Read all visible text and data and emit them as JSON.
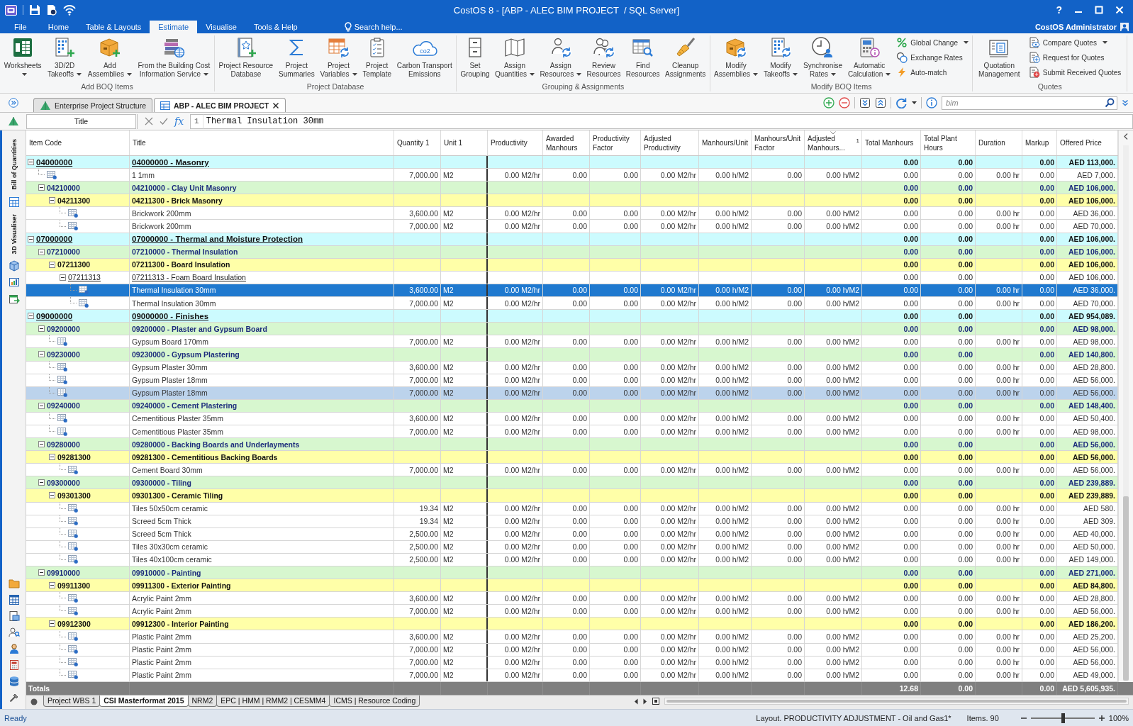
{
  "window": {
    "title": "CostOS 8 - [ABP - ALEC BIM PROJECT  / SQL Server]",
    "help": "?"
  },
  "menu": {
    "tabs": [
      {
        "label": "File",
        "selected": false
      },
      {
        "label": "Home",
        "selected": false
      },
      {
        "label": "Table & Layouts",
        "selected": false
      },
      {
        "label": "Estimate",
        "selected": true
      },
      {
        "label": "Visualise",
        "selected": false
      },
      {
        "label": "Tools & Help",
        "selected": false
      }
    ],
    "search": {
      "placeholder": "Search help..."
    },
    "user": "CostOS Administrator"
  },
  "ribbon": {
    "groups": [
      {
        "label": "Add BOQ Items",
        "buttons": [
          {
            "kind": "large",
            "label": "Worksheets",
            "has_menu": true
          },
          {
            "kind": "large",
            "label": "3D/2D Takeoffs",
            "has_menu": true
          },
          {
            "kind": "large",
            "label": "Add Assemblies",
            "has_menu": true
          },
          {
            "kind": "large",
            "label": "From the Building Cost Information Service",
            "has_menu": true
          }
        ]
      },
      {
        "label": "Project Database",
        "buttons": [
          {
            "kind": "large",
            "label": "Project Resource Database",
            "has_menu": false
          },
          {
            "kind": "large",
            "label": "Project Summaries",
            "has_menu": false
          },
          {
            "kind": "large",
            "label": "Project Variables",
            "has_menu": true
          },
          {
            "kind": "large",
            "label": "Project Template",
            "has_menu": false
          },
          {
            "kind": "large",
            "label": "Carbon Transport Emissions",
            "has_menu": false,
            "icon_text": "co2"
          }
        ]
      },
      {
        "label": "Grouping & Assignments",
        "buttons": [
          {
            "kind": "large",
            "label": "Set Grouping",
            "has_menu": false
          },
          {
            "kind": "large",
            "label": "Assign Quantities",
            "has_menu": true
          },
          {
            "kind": "large",
            "label": "Assign Resources",
            "has_menu": true
          },
          {
            "kind": "large",
            "label": "Review Resources",
            "has_menu": false
          },
          {
            "kind": "large",
            "label": "Find Resources",
            "has_menu": false
          },
          {
            "kind": "large",
            "label": "Cleanup Assignments",
            "has_menu": false
          }
        ]
      },
      {
        "label": "Modify BOQ Items",
        "buttons": [
          {
            "kind": "large",
            "label": "Modify Assemblies",
            "has_menu": true
          },
          {
            "kind": "large",
            "label": "Modify Takeoffs",
            "has_menu": true
          },
          {
            "kind": "large",
            "label": "Synchronise Rates",
            "has_menu": true
          },
          {
            "kind": "large",
            "label": "Automatic Calculation",
            "has_menu": true
          },
          {
            "kind": "small",
            "label": "Global Change",
            "has_menu": true
          },
          {
            "kind": "small",
            "label": "Exchange Rates",
            "has_menu": false
          },
          {
            "kind": "small",
            "label": "Auto-match",
            "has_menu": false
          }
        ]
      },
      {
        "label": "Quotes",
        "buttons": [
          {
            "kind": "large",
            "label": "Quotation Management",
            "has_menu": false
          },
          {
            "kind": "small",
            "label": "Compare Quotes",
            "has_menu": true
          },
          {
            "kind": "small",
            "label": "Request for Quotes",
            "has_menu": false
          },
          {
            "kind": "small",
            "label": "Submit Received Quotes",
            "has_menu": false
          }
        ]
      }
    ]
  },
  "document_tabs": [
    {
      "label": "Enterprise Project Structure",
      "selected": false,
      "closable": false
    },
    {
      "label": "ABP - ALEC BIM PROJECT",
      "selected": true,
      "closable": true
    }
  ],
  "toolbar": {
    "search": {
      "value": "bim"
    }
  },
  "formula_bar": {
    "field": "Title",
    "function_label": "fx",
    "line_number": "1",
    "value": "Thermal Insulation 30mm"
  },
  "side_panel": {
    "tabs": [
      {
        "label": "Bill of Quantities"
      },
      {
        "label": "3D Visualiser"
      }
    ]
  },
  "table": {
    "columns": [
      {
        "label": "Item Code"
      },
      {
        "label": "Title"
      },
      {
        "label": "Quantity 1"
      },
      {
        "label": "Unit 1"
      },
      {
        "label": "Productivity"
      },
      {
        "label": "Awarded Manhours"
      },
      {
        "label": "Productivity Factor"
      },
      {
        "label": "Adjusted Productivity"
      },
      {
        "label": "Manhours/Unit"
      },
      {
        "label": "Manhours/Unit Factor"
      },
      {
        "label": "Adjusted Manhours...",
        "sort_index": "1"
      },
      {
        "label": "Total Manhours"
      },
      {
        "label": "Total Plant Hours"
      },
      {
        "label": "Duration"
      },
      {
        "label": "Markup"
      },
      {
        "label": "Offered Price"
      }
    ],
    "rows": [
      {
        "kind": "group",
        "code": "04000000",
        "title": "04000000 - Masonry",
        "expanded": true,
        "selected": false,
        "focused": false,
        "total_manhours": "0.00",
        "total_plant_hours": "0.00",
        "markup": "0.00",
        "offered_price": "AED 113,000.",
        "children": [
          {
            "kind": "item",
            "title": "1 1mm",
            "quantity_1": "7,000.00",
            "unit_1": "M2",
            "productivity": "0.00 M2/hr",
            "awarded_manhours": "0.00",
            "productivity_factor": "0.00",
            "adjusted_productivity": "0.00 M2/hr",
            "manhours_per_unit": "0.00 h/M2",
            "manhours_per_unit_factor": "0.00",
            "adjusted_manhours": "0.00 h/M2",
            "total_manhours": "0.00",
            "total_plant_hours": "0.00",
            "duration": "0.00 hr",
            "markup": "0.00",
            "offered_price": "AED 7,000.",
            "selected": false,
            "focused": false
          },
          {
            "kind": "group",
            "code": "04210000",
            "title": "04210000 - Clay Unit Masonry",
            "expanded": true,
            "selected": false,
            "focused": false,
            "total_manhours": "0.00",
            "total_plant_hours": "0.00",
            "markup": "0.00",
            "offered_price": "AED 106,000.",
            "children": [
              {
                "kind": "group",
                "code": "04211300",
                "title": "04211300 - Brick Masonry",
                "expanded": true,
                "selected": false,
                "focused": false,
                "total_manhours": "0.00",
                "total_plant_hours": "0.00",
                "markup": "0.00",
                "offered_price": "AED 106,000.",
                "children": [
                  {
                    "kind": "item",
                    "title": "Brickwork 200mm",
                    "quantity_1": "3,600.00",
                    "unit_1": "M2",
                    "productivity": "0.00 M2/hr",
                    "awarded_manhours": "0.00",
                    "productivity_factor": "0.00",
                    "adjusted_productivity": "0.00 M2/hr",
                    "manhours_per_unit": "0.00 h/M2",
                    "manhours_per_unit_factor": "0.00",
                    "adjusted_manhours": "0.00 h/M2",
                    "total_manhours": "0.00",
                    "total_plant_hours": "0.00",
                    "duration": "0.00 hr",
                    "markup": "0.00",
                    "offered_price": "AED 36,000.",
                    "selected": false,
                    "focused": false
                  },
                  {
                    "kind": "item",
                    "title": "Brickwork 200mm",
                    "quantity_1": "7,000.00",
                    "unit_1": "M2",
                    "productivity": "0.00 M2/hr",
                    "awarded_manhours": "0.00",
                    "productivity_factor": "0.00",
                    "adjusted_productivity": "0.00 M2/hr",
                    "manhours_per_unit": "0.00 h/M2",
                    "manhours_per_unit_factor": "0.00",
                    "adjusted_manhours": "0.00 h/M2",
                    "total_manhours": "0.00",
                    "total_plant_hours": "0.00",
                    "duration": "0.00 hr",
                    "markup": "0.00",
                    "offered_price": "AED 70,000.",
                    "selected": false,
                    "focused": false
                  }
                ]
              }
            ]
          }
        ]
      },
      {
        "kind": "group",
        "code": "07000000",
        "title": "07000000 - Thermal and Moisture Protection",
        "expanded": true,
        "selected": false,
        "focused": false,
        "total_manhours": "0.00",
        "total_plant_hours": "0.00",
        "markup": "0.00",
        "offered_price": "AED 106,000.",
        "children": [
          {
            "kind": "group",
            "code": "07210000",
            "title": "07210000 - Thermal Insulation",
            "expanded": true,
            "selected": false,
            "focused": false,
            "total_manhours": "0.00",
            "total_plant_hours": "0.00",
            "markup": "0.00",
            "offered_price": "AED 106,000.",
            "children": [
              {
                "kind": "group",
                "code": "07211300",
                "title": "07211300 - Board Insulation",
                "expanded": true,
                "selected": false,
                "focused": false,
                "total_manhours": "0.00",
                "total_plant_hours": "0.00",
                "markup": "0.00",
                "offered_price": "AED 106,000.",
                "children": [
                  {
                    "kind": "group",
                    "code": "07211313",
                    "title": "07211313 - Foam Board Insulation",
                    "expanded": true,
                    "selected": false,
                    "focused": false,
                    "total_manhours": "0.00",
                    "total_plant_hours": "0.00",
                    "markup": "0.00",
                    "offered_price": "AED 106,000.",
                    "children": [
                      {
                        "kind": "item",
                        "title": "Thermal Insulation 30mm",
                        "quantity_1": "3,600.00",
                        "unit_1": "M2",
                        "productivity": "0.00 M2/hr",
                        "awarded_manhours": "0.00",
                        "productivity_factor": "0.00",
                        "adjusted_productivity": "0.00 M2/hr",
                        "manhours_per_unit": "0.00 h/M2",
                        "manhours_per_unit_factor": "0.00",
                        "adjusted_manhours": "0.00 h/M2",
                        "total_manhours": "0.00",
                        "total_plant_hours": "0.00",
                        "duration": "0.00 hr",
                        "markup": "0.00",
                        "offered_price": "AED 36,000.",
                        "selected": true,
                        "focused": true
                      },
                      {
                        "kind": "item",
                        "title": "Thermal Insulation 30mm",
                        "quantity_1": "7,000.00",
                        "unit_1": "M2",
                        "productivity": "0.00 M2/hr",
                        "awarded_manhours": "0.00",
                        "productivity_factor": "0.00",
                        "adjusted_productivity": "0.00 M2/hr",
                        "manhours_per_unit": "0.00 h/M2",
                        "manhours_per_unit_factor": "0.00",
                        "adjusted_manhours": "0.00 h/M2",
                        "total_manhours": "0.00",
                        "total_plant_hours": "0.00",
                        "duration": "0.00 hr",
                        "markup": "0.00",
                        "offered_price": "AED 70,000.",
                        "selected": false,
                        "focused": false
                      }
                    ]
                  }
                ]
              }
            ]
          }
        ]
      },
      {
        "kind": "group",
        "code": "09000000",
        "title": "09000000 - Finishes",
        "expanded": true,
        "selected": false,
        "focused": false,
        "total_manhours": "0.00",
        "total_plant_hours": "0.00",
        "markup": "0.00",
        "offered_price": "AED 954,089.",
        "children": [
          {
            "kind": "group",
            "code": "09200000",
            "title": "09200000 - Plaster and Gypsum Board",
            "expanded": true,
            "selected": false,
            "focused": false,
            "total_manhours": "0.00",
            "total_plant_hours": "0.00",
            "markup": "0.00",
            "offered_price": "AED 98,000.",
            "children": [
              {
                "kind": "item",
                "title": "Gypsum Board 170mm",
                "quantity_1": "7,000.00",
                "unit_1": "M2",
                "productivity": "0.00 M2/hr",
                "awarded_manhours": "0.00",
                "productivity_factor": "0.00",
                "adjusted_productivity": "0.00 M2/hr",
                "manhours_per_unit": "0.00 h/M2",
                "manhours_per_unit_factor": "0.00",
                "adjusted_manhours": "0.00 h/M2",
                "total_manhours": "0.00",
                "total_plant_hours": "0.00",
                "duration": "0.00 hr",
                "markup": "0.00",
                "offered_price": "AED 98,000.",
                "selected": false,
                "focused": false
              }
            ]
          },
          {
            "kind": "group",
            "code": "09230000",
            "title": "09230000 - Gypsum Plastering",
            "expanded": true,
            "selected": false,
            "focused": false,
            "total_manhours": "0.00",
            "total_plant_hours": "0.00",
            "markup": "0.00",
            "offered_price": "AED 140,800.",
            "children": [
              {
                "kind": "item",
                "title": "Gypsum Plaster 30mm",
                "quantity_1": "3,600.00",
                "unit_1": "M2",
                "productivity": "0.00 M2/hr",
                "awarded_manhours": "0.00",
                "productivity_factor": "0.00",
                "adjusted_productivity": "0.00 M2/hr",
                "manhours_per_unit": "0.00 h/M2",
                "manhours_per_unit_factor": "0.00",
                "adjusted_manhours": "0.00 h/M2",
                "total_manhours": "0.00",
                "total_plant_hours": "0.00",
                "duration": "0.00 hr",
                "markup": "0.00",
                "offered_price": "AED 28,800.",
                "selected": false,
                "focused": false
              },
              {
                "kind": "item",
                "title": "Gypsum Plaster 18mm",
                "quantity_1": "7,000.00",
                "unit_1": "M2",
                "productivity": "0.00 M2/hr",
                "awarded_manhours": "0.00",
                "productivity_factor": "0.00",
                "adjusted_productivity": "0.00 M2/hr",
                "manhours_per_unit": "0.00 h/M2",
                "manhours_per_unit_factor": "0.00",
                "adjusted_manhours": "0.00 h/M2",
                "total_manhours": "0.00",
                "total_plant_hours": "0.00",
                "duration": "0.00 hr",
                "markup": "0.00",
                "offered_price": "AED 56,000.",
                "selected": false,
                "focused": false
              },
              {
                "kind": "item",
                "title": "Gypsum Plaster 18mm",
                "quantity_1": "7,000.00",
                "unit_1": "M2",
                "productivity": "0.00 M2/hr",
                "awarded_manhours": "0.00",
                "productivity_factor": "0.00",
                "adjusted_productivity": "0.00 M2/hr",
                "manhours_per_unit": "0.00 h/M2",
                "manhours_per_unit_factor": "0.00",
                "adjusted_manhours": "0.00 h/M2",
                "total_manhours": "0.00",
                "total_plant_hours": "0.00",
                "duration": "0.00 hr",
                "markup": "0.00",
                "offered_price": "AED 56,000.",
                "selected": true,
                "focused": false
              }
            ]
          },
          {
            "kind": "group",
            "code": "09240000",
            "title": "09240000 - Cement Plastering",
            "expanded": true,
            "selected": false,
            "focused": false,
            "total_manhours": "0.00",
            "total_plant_hours": "0.00",
            "markup": "0.00",
            "offered_price": "AED 148,400.",
            "children": [
              {
                "kind": "item",
                "title": "Cementitious Plaster 35mm",
                "quantity_1": "3,600.00",
                "unit_1": "M2",
                "productivity": "0.00 M2/hr",
                "awarded_manhours": "0.00",
                "productivity_factor": "0.00",
                "adjusted_productivity": "0.00 M2/hr",
                "manhours_per_unit": "0.00 h/M2",
                "manhours_per_unit_factor": "0.00",
                "adjusted_manhours": "0.00 h/M2",
                "total_manhours": "0.00",
                "total_plant_hours": "0.00",
                "duration": "0.00 hr",
                "markup": "0.00",
                "offered_price": "AED 50,400.",
                "selected": false,
                "focused": false
              },
              {
                "kind": "item",
                "title": "Cementitious Plaster 35mm",
                "quantity_1": "7,000.00",
                "unit_1": "M2",
                "productivity": "0.00 M2/hr",
                "awarded_manhours": "0.00",
                "productivity_factor": "0.00",
                "adjusted_productivity": "0.00 M2/hr",
                "manhours_per_unit": "0.00 h/M2",
                "manhours_per_unit_factor": "0.00",
                "adjusted_manhours": "0.00 h/M2",
                "total_manhours": "0.00",
                "total_plant_hours": "0.00",
                "duration": "0.00 hr",
                "markup": "0.00",
                "offered_price": "AED 98,000.",
                "selected": false,
                "focused": false
              }
            ]
          },
          {
            "kind": "group",
            "code": "09280000",
            "title": "09280000 - Backing Boards and Underlayments",
            "expanded": true,
            "selected": false,
            "focused": false,
            "total_manhours": "0.00",
            "total_plant_hours": "0.00",
            "markup": "0.00",
            "offered_price": "AED 56,000.",
            "children": [
              {
                "kind": "group",
                "code": "09281300",
                "title": "09281300 - Cementitious Backing Boards",
                "expanded": true,
                "selected": false,
                "focused": false,
                "total_manhours": "0.00",
                "total_plant_hours": "0.00",
                "markup": "0.00",
                "offered_price": "AED 56,000.",
                "children": [
                  {
                    "kind": "item",
                    "title": "Cement Board 30mm",
                    "quantity_1": "7,000.00",
                    "unit_1": "M2",
                    "productivity": "0.00 M2/hr",
                    "awarded_manhours": "0.00",
                    "productivity_factor": "0.00",
                    "adjusted_productivity": "0.00 M2/hr",
                    "manhours_per_unit": "0.00 h/M2",
                    "manhours_per_unit_factor": "0.00",
                    "adjusted_manhours": "0.00 h/M2",
                    "total_manhours": "0.00",
                    "total_plant_hours": "0.00",
                    "duration": "0.00 hr",
                    "markup": "0.00",
                    "offered_price": "AED 56,000.",
                    "selected": false,
                    "focused": false
                  }
                ]
              }
            ]
          },
          {
            "kind": "group",
            "code": "09300000",
            "title": "09300000 - Tiling",
            "expanded": true,
            "selected": false,
            "focused": false,
            "total_manhours": "0.00",
            "total_plant_hours": "0.00",
            "markup": "0.00",
            "offered_price": "AED 239,889.",
            "children": [
              {
                "kind": "group",
                "code": "09301300",
                "title": "09301300 - Ceramic Tiling",
                "expanded": true,
                "selected": false,
                "focused": false,
                "total_manhours": "0.00",
                "total_plant_hours": "0.00",
                "markup": "0.00",
                "offered_price": "AED 239,889.",
                "children": [
                  {
                    "kind": "item",
                    "title": "Tiles 50x50cm ceramic",
                    "quantity_1": "19.34",
                    "unit_1": "M2",
                    "productivity": "0.00 M2/hr",
                    "awarded_manhours": "0.00",
                    "productivity_factor": "0.00",
                    "adjusted_productivity": "0.00 M2/hr",
                    "manhours_per_unit": "0.00 h/M2",
                    "manhours_per_unit_factor": "0.00",
                    "adjusted_manhours": "0.00 h/M2",
                    "total_manhours": "0.00",
                    "total_plant_hours": "0.00",
                    "duration": "0.00 hr",
                    "markup": "0.00",
                    "offered_price": "AED 580.",
                    "selected": false,
                    "focused": false
                  },
                  {
                    "kind": "item",
                    "title": "Screed 5cm Thick",
                    "quantity_1": "19.34",
                    "unit_1": "M2",
                    "productivity": "0.00 M2/hr",
                    "awarded_manhours": "0.00",
                    "productivity_factor": "0.00",
                    "adjusted_productivity": "0.00 M2/hr",
                    "manhours_per_unit": "0.00 h/M2",
                    "manhours_per_unit_factor": "0.00",
                    "adjusted_manhours": "0.00 h/M2",
                    "total_manhours": "0.00",
                    "total_plant_hours": "0.00",
                    "duration": "0.00 hr",
                    "markup": "0.00",
                    "offered_price": "AED 309.",
                    "selected": false,
                    "focused": false
                  },
                  {
                    "kind": "item",
                    "title": "Screed 5cm Thick",
                    "quantity_1": "2,500.00",
                    "unit_1": "M2",
                    "productivity": "0.00 M2/hr",
                    "awarded_manhours": "0.00",
                    "productivity_factor": "0.00",
                    "adjusted_productivity": "0.00 M2/hr",
                    "manhours_per_unit": "0.00 h/M2",
                    "manhours_per_unit_factor": "0.00",
                    "adjusted_manhours": "0.00 h/M2",
                    "total_manhours": "0.00",
                    "total_plant_hours": "0.00",
                    "duration": "0.00 hr",
                    "markup": "0.00",
                    "offered_price": "AED 40,000.",
                    "selected": false,
                    "focused": false
                  },
                  {
                    "kind": "item",
                    "title": "Tiles 30x30cm ceramic",
                    "quantity_1": "2,500.00",
                    "unit_1": "M2",
                    "productivity": "0.00 M2/hr",
                    "awarded_manhours": "0.00",
                    "productivity_factor": "0.00",
                    "adjusted_productivity": "0.00 M2/hr",
                    "manhours_per_unit": "0.00 h/M2",
                    "manhours_per_unit_factor": "0.00",
                    "adjusted_manhours": "0.00 h/M2",
                    "total_manhours": "0.00",
                    "total_plant_hours": "0.00",
                    "duration": "0.00 hr",
                    "markup": "0.00",
                    "offered_price": "AED 50,000.",
                    "selected": false,
                    "focused": false
                  },
                  {
                    "kind": "item",
                    "title": "Tiles 40x100cm ceramic",
                    "quantity_1": "2,500.00",
                    "unit_1": "M2",
                    "productivity": "0.00 M2/hr",
                    "awarded_manhours": "0.00",
                    "productivity_factor": "0.00",
                    "adjusted_productivity": "0.00 M2/hr",
                    "manhours_per_unit": "0.00 h/M2",
                    "manhours_per_unit_factor": "0.00",
                    "adjusted_manhours": "0.00 h/M2",
                    "total_manhours": "0.00",
                    "total_plant_hours": "0.00",
                    "duration": "0.00 hr",
                    "markup": "0.00",
                    "offered_price": "AED 149,000.",
                    "selected": false,
                    "focused": false
                  }
                ]
              }
            ]
          },
          {
            "kind": "group",
            "code": "09910000",
            "title": "09910000 - Painting",
            "expanded": true,
            "selected": false,
            "focused": false,
            "total_manhours": "0.00",
            "total_plant_hours": "0.00",
            "markup": "0.00",
            "offered_price": "AED 271,000.",
            "children": [
              {
                "kind": "group",
                "code": "09911300",
                "title": "09911300 - Exterior Painting",
                "expanded": true,
                "selected": false,
                "focused": false,
                "total_manhours": "0.00",
                "total_plant_hours": "0.00",
                "markup": "0.00",
                "offered_price": "AED 84,800.",
                "children": [
                  {
                    "kind": "item",
                    "title": "Acrylic Paint 2mm",
                    "quantity_1": "3,600.00",
                    "unit_1": "M2",
                    "productivity": "0.00 M2/hr",
                    "awarded_manhours": "0.00",
                    "productivity_factor": "0.00",
                    "adjusted_productivity": "0.00 M2/hr",
                    "manhours_per_unit": "0.00 h/M2",
                    "manhours_per_unit_factor": "0.00",
                    "adjusted_manhours": "0.00 h/M2",
                    "total_manhours": "0.00",
                    "total_plant_hours": "0.00",
                    "duration": "0.00 hr",
                    "markup": "0.00",
                    "offered_price": "AED 28,800.",
                    "selected": false,
                    "focused": false
                  },
                  {
                    "kind": "item",
                    "title": "Acrylic Paint 2mm",
                    "quantity_1": "7,000.00",
                    "unit_1": "M2",
                    "productivity": "0.00 M2/hr",
                    "awarded_manhours": "0.00",
                    "productivity_factor": "0.00",
                    "adjusted_productivity": "0.00 M2/hr",
                    "manhours_per_unit": "0.00 h/M2",
                    "manhours_per_unit_factor": "0.00",
                    "adjusted_manhours": "0.00 h/M2",
                    "total_manhours": "0.00",
                    "total_plant_hours": "0.00",
                    "duration": "0.00 hr",
                    "markup": "0.00",
                    "offered_price": "AED 56,000.",
                    "selected": false,
                    "focused": false
                  }
                ]
              },
              {
                "kind": "group",
                "code": "09912300",
                "title": "09912300 - Interior Painting",
                "expanded": true,
                "selected": false,
                "focused": false,
                "total_manhours": "0.00",
                "total_plant_hours": "0.00",
                "markup": "0.00",
                "offered_price": "AED 186,200.",
                "children": [
                  {
                    "kind": "item",
                    "title": "Plastic Paint 2mm",
                    "quantity_1": "3,600.00",
                    "unit_1": "M2",
                    "productivity": "0.00 M2/hr",
                    "awarded_manhours": "0.00",
                    "productivity_factor": "0.00",
                    "adjusted_productivity": "0.00 M2/hr",
                    "manhours_per_unit": "0.00 h/M2",
                    "manhours_per_unit_factor": "0.00",
                    "adjusted_manhours": "0.00 h/M2",
                    "total_manhours": "0.00",
                    "total_plant_hours": "0.00",
                    "duration": "0.00 hr",
                    "markup": "0.00",
                    "offered_price": "AED 25,200.",
                    "selected": false,
                    "focused": false
                  },
                  {
                    "kind": "item",
                    "title": "Plastic Paint 2mm",
                    "quantity_1": "7,000.00",
                    "unit_1": "M2",
                    "productivity": "0.00 M2/hr",
                    "awarded_manhours": "0.00",
                    "productivity_factor": "0.00",
                    "adjusted_productivity": "0.00 M2/hr",
                    "manhours_per_unit": "0.00 h/M2",
                    "manhours_per_unit_factor": "0.00",
                    "adjusted_manhours": "0.00 h/M2",
                    "total_manhours": "0.00",
                    "total_plant_hours": "0.00",
                    "duration": "0.00 hr",
                    "markup": "0.00",
                    "offered_price": "AED 56,000.",
                    "selected": false,
                    "focused": false
                  },
                  {
                    "kind": "item",
                    "title": "Plastic Paint 2mm",
                    "quantity_1": "7,000.00",
                    "unit_1": "M2",
                    "productivity": "0.00 M2/hr",
                    "awarded_manhours": "0.00",
                    "productivity_factor": "0.00",
                    "adjusted_productivity": "0.00 M2/hr",
                    "manhours_per_unit": "0.00 h/M2",
                    "manhours_per_unit_factor": "0.00",
                    "adjusted_manhours": "0.00 h/M2",
                    "total_manhours": "0.00",
                    "total_plant_hours": "0.00",
                    "duration": "0.00 hr",
                    "markup": "0.00",
                    "offered_price": "AED 56,000.",
                    "selected": false,
                    "focused": false
                  },
                  {
                    "kind": "item",
                    "title": "Plastic Paint 2mm",
                    "quantity_1": "7,000.00",
                    "unit_1": "M2",
                    "productivity": "0.00 M2/hr",
                    "awarded_manhours": "0.00",
                    "productivity_factor": "0.00",
                    "adjusted_productivity": "0.00 M2/hr",
                    "manhours_per_unit": "0.00 h/M2",
                    "manhours_per_unit_factor": "0.00",
                    "adjusted_manhours": "0.00 h/M2",
                    "total_manhours": "0.00",
                    "total_plant_hours": "0.00",
                    "duration": "0.00 hr",
                    "markup": "0.00",
                    "offered_price": "AED 49,000.",
                    "selected": false,
                    "focused": false
                  }
                ]
              }
            ]
          }
        ]
      }
    ],
    "totals": {
      "label": "Totals",
      "total_manhours": "12.68",
      "total_plant_hours": "0.00",
      "markup": "0.00",
      "offered_price": "AED 5,605,935."
    }
  },
  "sheet_tabs": [
    {
      "label": "Project WBS 1",
      "selected": false
    },
    {
      "label": "CSI Masterformat 2015",
      "selected": true
    },
    {
      "label": "NRM2",
      "selected": false
    },
    {
      "label": "EPC | HMM | RMM2 | CESMM4",
      "selected": false
    },
    {
      "label": "ICMS | Resource Coding",
      "selected": false
    }
  ],
  "status_bar": {
    "message": "Ready",
    "layout": "Layout. PRODUCTIVITY ADJUSTMENT - Oil and Gas1*",
    "items": "Items. 90",
    "zoom": {
      "level": 0.5,
      "reading": "100%"
    }
  }
}
